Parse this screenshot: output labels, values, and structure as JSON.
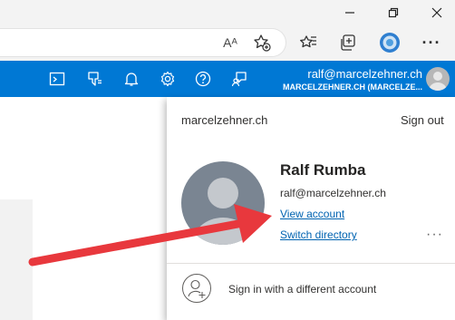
{
  "browser": {
    "window_controls": {
      "minimize_icon": "minimize-icon",
      "restore_icon": "restore-icon",
      "close_icon": "close-icon"
    },
    "toolbar_icons": [
      "read-aloud-icon",
      "add-favorite-icon",
      "favorites-icon",
      "collections-icon",
      "profile-icon",
      "more-icon"
    ],
    "read_aloud_glyph": "Aᴬ",
    "more_glyph": "···"
  },
  "header": {
    "icons": [
      "cloud-shell-icon",
      "directory-filter-icon",
      "notifications-icon",
      "settings-icon",
      "help-icon",
      "feedback-icon"
    ],
    "user_email": "ralf@marcelzehner.ch",
    "directory": "MARCELZEHNER.CH (MARCELZE...",
    "brand_color": "#0078d4"
  },
  "account_menu": {
    "tenant": "marcelzehner.ch",
    "sign_out": "Sign out",
    "name": "Ralf Rumba",
    "email": "ralf@marcelzehner.ch",
    "view_account": "View account",
    "switch_directory": "Switch directory",
    "more": "···",
    "other_account": "Sign in with a different account",
    "link_color": "#0063b1"
  },
  "annotation": {
    "arrow_color": "#e8383d"
  }
}
